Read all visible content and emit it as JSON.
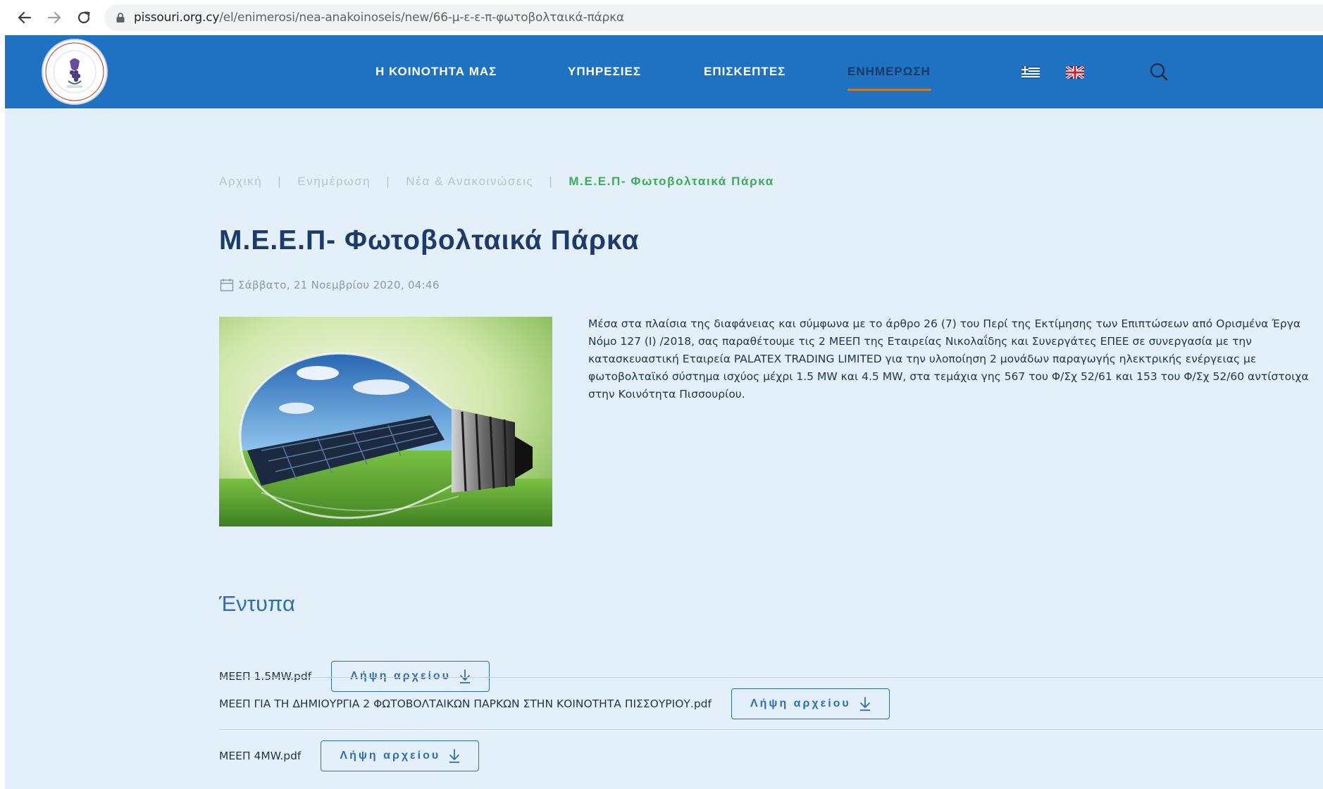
{
  "browser": {
    "url_host": "pissouri.org.cy",
    "url_path": "/el/enimerosi/nea-anakoinoseis/new/66-μ-ε-ε-π-φωτοβολταικά-πάρκα"
  },
  "header": {
    "menu": [
      {
        "label": "Η ΚΟΙΝΟΤΗΤΑ ΜΑΣ"
      },
      {
        "label": "ΥΠΗΡΕΣΙΕΣ"
      },
      {
        "label": "ΕΠΙΣΚΕΠΤΕΣ"
      },
      {
        "label": "ΕΝΗΜΕΡΩΣΗ"
      }
    ],
    "active_color": "#1a3a68",
    "accent_underline_color": "#c87a2a",
    "bar_color": "#1f72c1",
    "languages": [
      "greek-flag-icon",
      "uk-flag-icon"
    ]
  },
  "breadcrumb": {
    "items": [
      "Αρχική",
      "Ενημέρωση",
      "Νέα & Ανακοινώσεις",
      "Μ.Ε.Ε.Π- Φωτοβολταικά Πάρκα"
    ],
    "separator": "|"
  },
  "article": {
    "title": "Μ.Ε.Ε.Π- Φωτοβολταικά Πάρκα",
    "date": "Σάββατο, 21 Νοεμβρίου 2020, 04:46",
    "body": "Μέσα στα πλαίσια της διαφάνειας και σύμφωνα με το άρθρο 26 (7) του Περί της Εκτίμησης των Επιπτώσεων από Ορισμένα Έργα Νόμο 127 (Ι) /2018, σας παραθέτουμε τις 2 ΜΕΕΠ της Εταιρείας Νικολαΐδης και Συνεργάτες ΕΠΕΕ σε συνεργασία με την κατασκευαστική Εταιρεία PALATEX TRADING LIMITED για την υλοποίηση 2 μονάδων παραγωγής ηλεκτρικής ενέργειας με φωτοβολταϊκό σύστημα ισχύος μέχρι 1.5 MW και 4.5 MW, στα τεμάχια γης 567 του Φ/Σχ 52/61 και 153 του Φ/Σχ 52/60 αντίστοιχα στην Κοινότητα Πισσουρίου."
  },
  "documents": {
    "title": "Έντυπα",
    "download_label": "Λήψη αρχείου",
    "files": [
      {
        "name": "ΜΕΕΠ 1.5MW.pdf"
      },
      {
        "name": "ΜΕΕΠ ΓΙΑ ΤΗ ΔΗΜΙΟΥΡΓΙΑ 2 ΦΩΤΟΒΟΛΤΑΙΚΩΝ ΠΑΡΚΩΝ ΣΤΗΝ ΚΟΙΝΟΤΗΤΑ ΠΙΣΣΟΥΡΙΟΥ.pdf"
      },
      {
        "name": "ΜΕΕΠ 4MW.pdf"
      }
    ]
  }
}
